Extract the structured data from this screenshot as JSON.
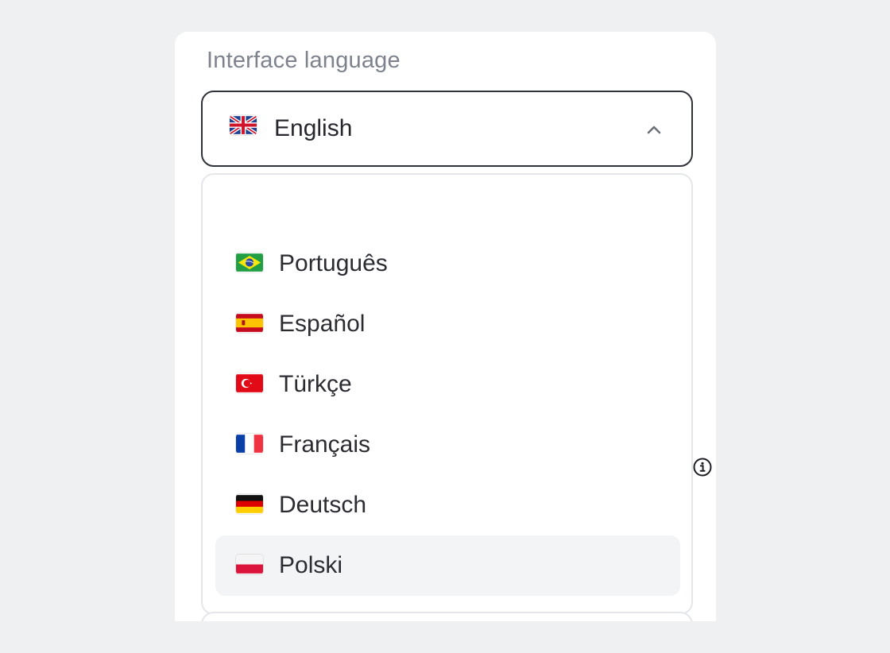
{
  "field": {
    "label": "Interface language"
  },
  "select": {
    "value": "English",
    "flag_icon": "uk-flag-icon",
    "chevron_icon": "chevron-up-icon",
    "expanded": true
  },
  "menu": {
    "options": [
      {
        "label": "Português",
        "flag_icon": "brazil-flag-icon"
      },
      {
        "label": "Español",
        "flag_icon": "spain-flag-icon"
      },
      {
        "label": "Türkçe",
        "flag_icon": "turkey-flag-icon"
      },
      {
        "label": "Français",
        "flag_icon": "france-flag-icon"
      },
      {
        "label": "Deutsch",
        "flag_icon": "germany-flag-icon"
      },
      {
        "label": "Polski",
        "flag_icon": "poland-flag-icon",
        "hovered": true
      }
    ]
  },
  "side": {
    "info_icon": "info-icon"
  },
  "colors": {
    "page_background": "#eef0f2",
    "select_border": "#2f3238",
    "menu_border": "#e4e6ea",
    "hover_background": "#f3f4f6",
    "label_text": "#7d828c"
  }
}
